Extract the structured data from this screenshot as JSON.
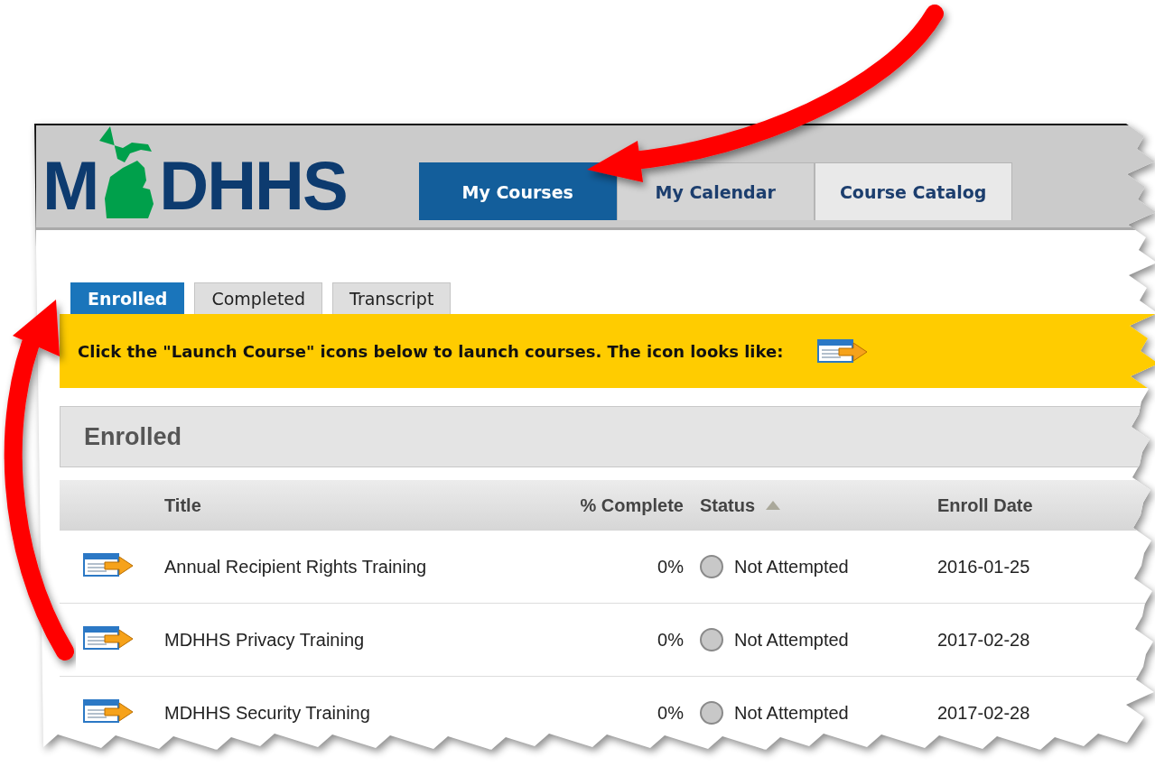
{
  "header": {
    "logo": {
      "left": "M",
      "right": "DHHS"
    },
    "nav_tabs": [
      {
        "label": "My Courses",
        "selected": true
      },
      {
        "label": "My Calendar",
        "selected": false
      },
      {
        "label": "Course Catalog",
        "selected": false
      }
    ]
  },
  "sub_tabs": [
    {
      "label": "Enrolled",
      "selected": true
    },
    {
      "label": "Completed",
      "selected": false
    },
    {
      "label": "Transcript",
      "selected": false
    }
  ],
  "notice": {
    "text": "Click the \"Launch Course\" icons below to launch courses. The icon looks like:"
  },
  "panel": {
    "title": "Enrolled"
  },
  "table": {
    "columns": [
      {
        "label": "Title",
        "sorted": false
      },
      {
        "label": "% Complete",
        "sorted": false
      },
      {
        "label": "Status",
        "sorted": true
      },
      {
        "label": "Enroll Date",
        "sorted": false
      }
    ],
    "rows": [
      {
        "title": "Annual Recipient Rights Training",
        "complete": "0%",
        "status": "Not Attempted",
        "enroll_date": "2016-01-25"
      },
      {
        "title": "MDHHS Privacy Training",
        "complete": "0%",
        "status": "Not Attempted",
        "enroll_date": "2017-02-28"
      },
      {
        "title": "MDHHS Security Training",
        "complete": "0%",
        "status": "Not Attempted",
        "enroll_date": "2017-02-28"
      }
    ]
  }
}
